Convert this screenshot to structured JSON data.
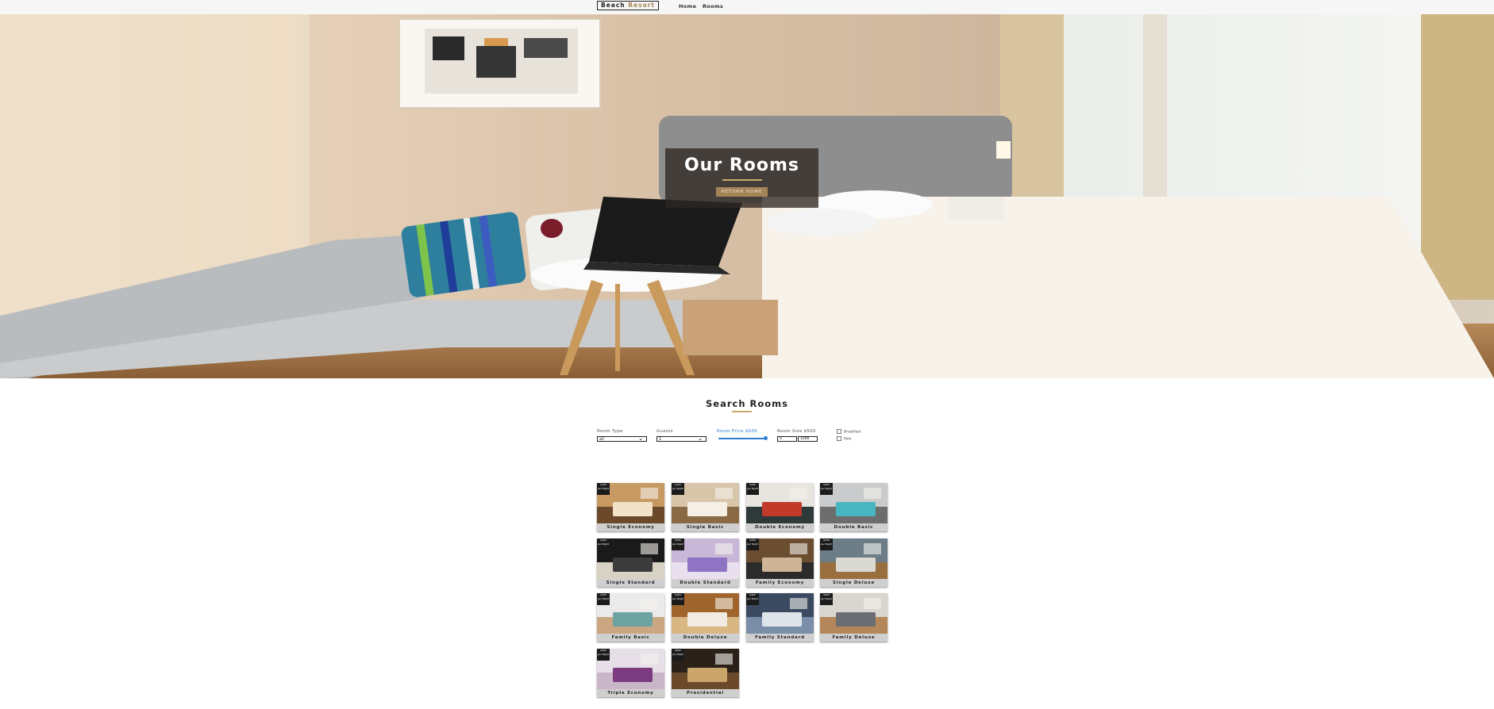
{
  "navbar": {
    "logo_part1": "Beach ",
    "logo_part2": "Resort",
    "links": [
      "Home",
      "Rooms"
    ]
  },
  "hero": {
    "title": "Our Rooms",
    "button_label": "RETURN HOME"
  },
  "search": {
    "title": "Search Rooms",
    "room_type_label": "Room Type",
    "room_type_value": "all",
    "guests_label": "Guests",
    "guests_value": "1",
    "price_label": "Room Price $600",
    "price_fraction": 1.0,
    "size_label": "Room Size $500",
    "size_min": "0",
    "size_max": "1000",
    "breakfast_label": "Breakfast",
    "pets_label": "Pets"
  },
  "colors": {
    "accent": "#c7a96e",
    "button": "#a48558",
    "slider": "#2d7dd2"
  },
  "rooms": [
    {
      "name": "Single Economy",
      "price": "$100",
      "per": "per Night"
    },
    {
      "name": "Single Basic",
      "price": "$150",
      "per": "per Night"
    },
    {
      "name": "Double Economy",
      "price": "$200",
      "per": "per Night"
    },
    {
      "name": "Double Basic",
      "price": "$250",
      "per": "per Night"
    },
    {
      "name": "Single Standard",
      "price": "$200",
      "per": "per Night"
    },
    {
      "name": "Double Standard",
      "price": "$300",
      "per": "per Night"
    },
    {
      "name": "Family Economy",
      "price": "$300",
      "per": "per Night"
    },
    {
      "name": "Single Deluxe",
      "price": "$300",
      "per": "per Night"
    },
    {
      "name": "Family Basic",
      "price": "$350",
      "per": "per Night"
    },
    {
      "name": "Double Deluxe",
      "price": "$400",
      "per": "per Night"
    },
    {
      "name": "Family Standard",
      "price": "$400",
      "per": "per Night"
    },
    {
      "name": "Family Deluxe",
      "price": "$500",
      "per": "per Night"
    },
    {
      "name": "Triple Economy",
      "price": "$400",
      "per": "per Night"
    },
    {
      "name": "Presidential",
      "price": "$600",
      "per": "per Night"
    }
  ]
}
